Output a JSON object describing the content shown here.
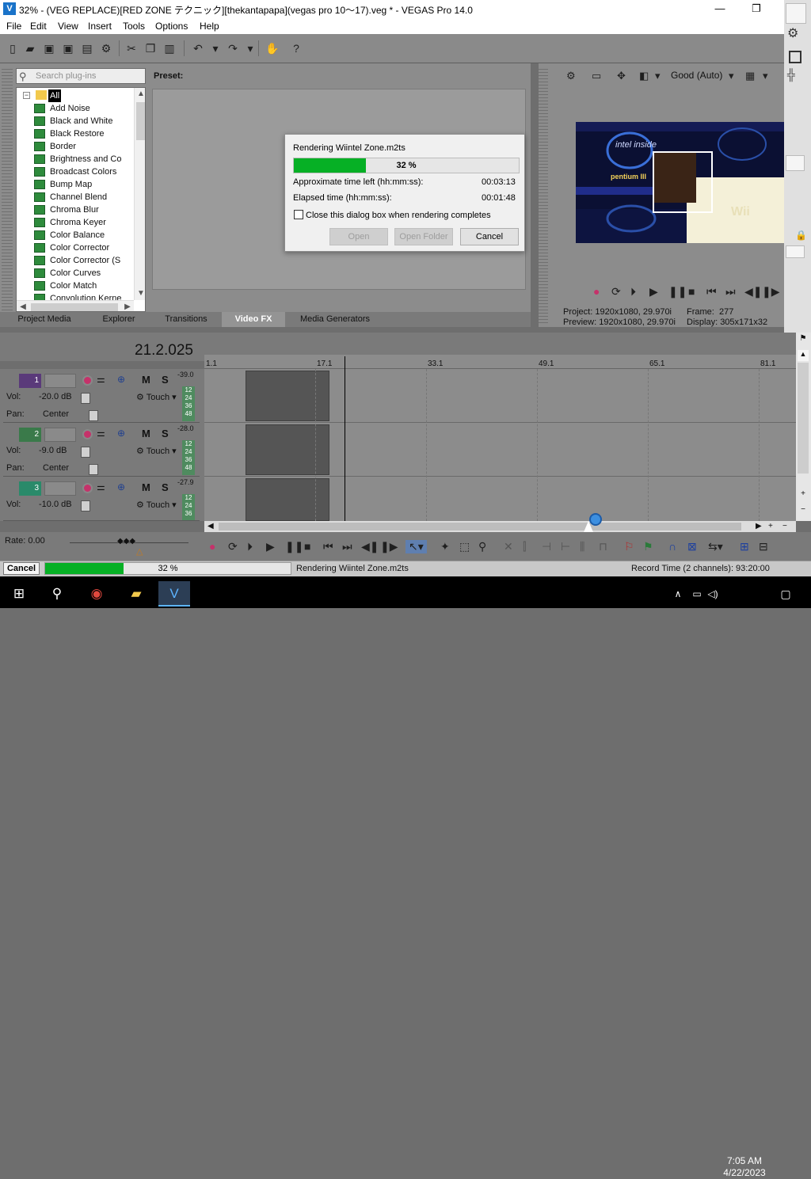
{
  "window": {
    "title": "32% - (VEG REPLACE)[RED ZONE テクニック][thekantapapa](vegas pro 10〜17).veg * - VEGAS Pro 14.0",
    "minimize": "—",
    "maximize": "❐",
    "close": "✕"
  },
  "menu": [
    "File",
    "Edit",
    "View",
    "Insert",
    "Tools",
    "Options",
    "Help"
  ],
  "plugins": {
    "search_placeholder": "Search plug-ins",
    "root": "All",
    "items": [
      "Add Noise",
      "Black and White",
      "Black Restore",
      "Border",
      "Brightness and Co",
      "Broadcast Colors",
      "Bump Map",
      "Channel Blend",
      "Chroma Blur",
      "Chroma Keyer",
      "Color Balance",
      "Color Corrector",
      "Color Corrector (S",
      "Color Curves",
      "Color Match",
      "Convolution Kerne"
    ]
  },
  "preset_label": "Preset:",
  "tabs": [
    "Project Media",
    "Explorer",
    "Transitions",
    "Video FX",
    "Media Generators"
  ],
  "active_tab": "Video FX",
  "render_dialog": {
    "title": "Rendering Wiintel Zone.m2ts",
    "progress_percent": 32,
    "progress_text": "32 %",
    "time_left_label": "Approximate time left (hh:mm:ss):",
    "time_left_value": "00:03:13",
    "elapsed_label": "Elapsed time (hh:mm:ss):",
    "elapsed_value": "00:01:48",
    "close_checkbox_label": "Close this dialog box when rendering completes",
    "open_button": "Open",
    "open_folder_button": "Open Folder",
    "cancel_button": "Cancel"
  },
  "preview": {
    "quality": "Good (Auto)",
    "project_label": "Project:",
    "project_value": "1920x1080, 29.970i",
    "preview_label": "Preview:",
    "preview_value": "1920x1080, 29.970i",
    "frame_label": "Frame:",
    "frame_value": "277",
    "display_label": "Display:",
    "display_value": "305x171x32",
    "image_text_intel": "intel inside",
    "image_text_pentium": "pentium III",
    "image_text_wii": "Wii"
  },
  "timeline": {
    "timecode": "21.2.025",
    "ruler_labels": [
      "1.1",
      "17.1",
      "33.1",
      "49.1",
      "65.1",
      "81.1"
    ],
    "tracks": [
      {
        "num": "1",
        "color": "#5a3a7a",
        "vol_label": "Vol:",
        "vol": "-20.0 dB",
        "pan_label": "Pan:",
        "pan": "Center",
        "touch": "Touch",
        "peak": "-39.0",
        "meter": [
          "12",
          "24",
          "36",
          "48"
        ]
      },
      {
        "num": "2",
        "color": "#3a7a4a",
        "vol_label": "Vol:",
        "vol": "-9.0 dB",
        "pan_label": "Pan:",
        "pan": "Center",
        "touch": "Touch",
        "peak": "-28.0",
        "meter": [
          "12",
          "24",
          "36",
          "48"
        ]
      },
      {
        "num": "3",
        "color": "#2a8a6a",
        "vol_label": "Vol:",
        "vol": "-10.0 dB",
        "pan_label": "Pan:",
        "pan": "",
        "touch": "Touch",
        "peak": "-27.9",
        "meter": [
          "12",
          "24",
          "36"
        ]
      }
    ],
    "m_label": "M",
    "s_label": "S"
  },
  "rate": "Rate: 0.00",
  "status": {
    "cancel": "Cancel",
    "progress_percent": 32,
    "progress_text": "32 %",
    "message": "Rendering Wiintel Zone.m2ts",
    "record_time": "Record Time (2 channels): 93:20:00"
  },
  "taskbar": {
    "time": "7:05 AM",
    "date": "4/22/2023"
  },
  "colors": {
    "progress_green": "#06b025",
    "accent_blue": "#1a73c9"
  }
}
